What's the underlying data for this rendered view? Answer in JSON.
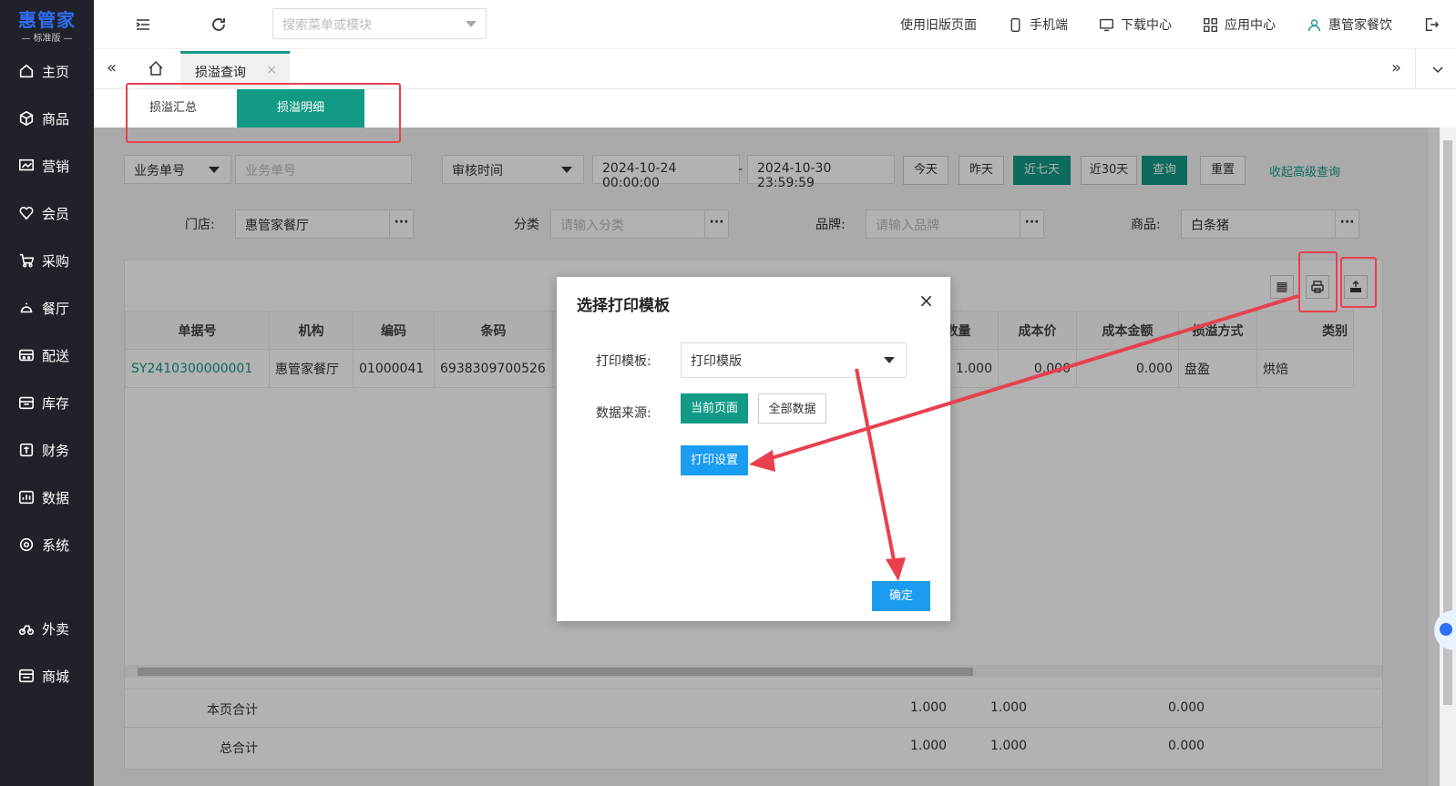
{
  "app": {
    "logo": "惠管家",
    "edition": "— 标准版 —"
  },
  "sidebar": {
    "items": [
      {
        "label": "主页",
        "icon": "home-icon"
      },
      {
        "label": "商品",
        "icon": "box-icon"
      },
      {
        "label": "营销",
        "icon": "chart-icon"
      },
      {
        "label": "会员",
        "icon": "heart-icon"
      },
      {
        "label": "采购",
        "icon": "cart-icon"
      },
      {
        "label": "餐厅",
        "icon": "bell-icon"
      },
      {
        "label": "配送",
        "icon": "truck-icon"
      },
      {
        "label": "库存",
        "icon": "warehouse-icon"
      },
      {
        "label": "财务",
        "icon": "money-icon"
      },
      {
        "label": "数据",
        "icon": "data-icon"
      },
      {
        "label": "系统",
        "icon": "settings-icon"
      }
    ],
    "extra_items": [
      {
        "label": "外卖",
        "icon": "bike-icon"
      },
      {
        "label": "商城",
        "icon": "shop-icon"
      }
    ]
  },
  "topbar": {
    "search_placeholder": "搜索菜单或模块",
    "old_page": "使用旧版页面",
    "mobile": "手机端",
    "download": "下载中心",
    "apps": "应用中心",
    "user": "惠管家餐饮"
  },
  "tabs": {
    "current": "损溢查询",
    "close": "×"
  },
  "subtabs": {
    "summary": "损溢汇总",
    "detail": "损溢明细"
  },
  "filters": {
    "doc_type": "业务单号",
    "doc_placeholder": "业务单号",
    "time_type": "审核时间",
    "start": "2024-10-24 00:00:00",
    "sep": "-",
    "end": "2024-10-30 23:59:59",
    "today": "今天",
    "yesterday": "昨天",
    "week": "近七天",
    "month": "近30天",
    "query": "查询",
    "reset": "重置",
    "collapse": "收起高级查询",
    "store_label": "门店:",
    "store_value": "惠管家餐厅",
    "cat_label": "分类",
    "cat_ph": "请输入分类",
    "brand_label": "品牌:",
    "brand_ph": "请输入品牌",
    "goods_label": "商品:",
    "goods_value": "白条猪",
    "dots": "···"
  },
  "table": {
    "headers": [
      "单据号",
      "机构",
      "编码",
      "条码",
      "",
      "",
      "",
      "",
      "",
      "数量",
      "成本价",
      "成本金额",
      "损溢方式",
      "类别"
    ],
    "row": [
      "SY2410300000001",
      "惠管家餐厅",
      "01000041",
      "6938309700526",
      "",
      "",
      "",
      "",
      "",
      "1.000",
      "0.000",
      "0.000",
      "盘盈",
      "烘焙"
    ],
    "page_total": {
      "label": "本页合计",
      "qty1": "1.000",
      "qty2": "1.000",
      "amount": "0.000"
    },
    "grand_total": {
      "label": "总合计",
      "qty1": "1.000",
      "qty2": "1.000",
      "amount": "0.000"
    }
  },
  "modal": {
    "title": "选择打印模板",
    "close": "×",
    "template_label": "打印模板:",
    "template_value": "打印模版",
    "source_label": "数据来源:",
    "current_page": "当前页面",
    "all_data": "全部数据",
    "print_settings": "打印设置",
    "confirm": "确定"
  },
  "colors": {
    "accent": "#129a86",
    "blue": "#1a9cf0",
    "annotation": "#e8404f",
    "sidebar": "#1f2329"
  }
}
